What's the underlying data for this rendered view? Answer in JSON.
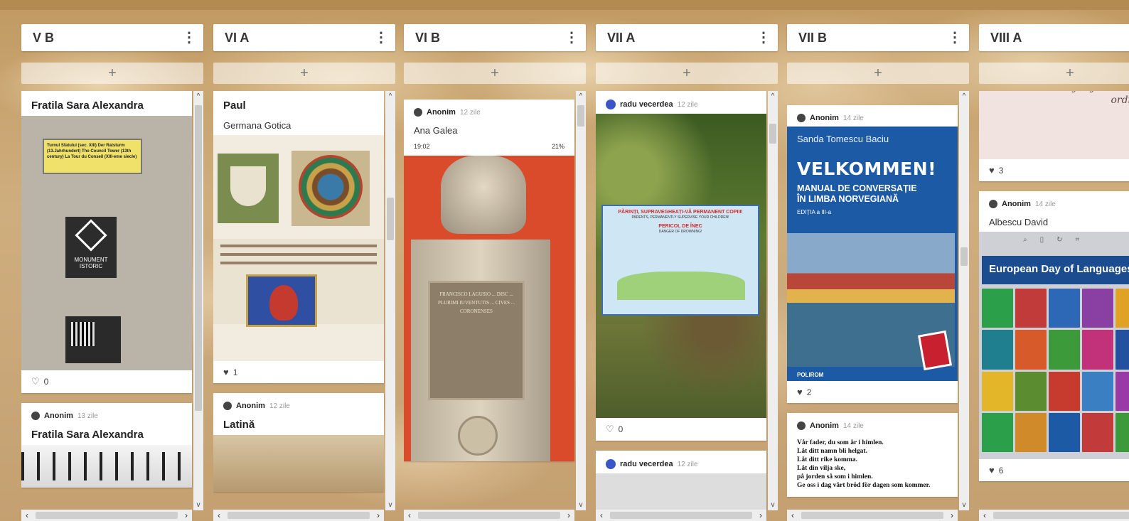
{
  "columns": [
    {
      "title": "V B",
      "add_label": "+",
      "cards": [
        {
          "title": "Fratila Sara Alexandra",
          "likes": "0"
        },
        {
          "author": "Anonim",
          "age": "13 zile",
          "title": "Fratila Sara Alexandra"
        }
      ],
      "sign": {
        "yellow": "Turnul Sfatului (sec. XIII) Der Ratsturm (13.Jahrhundert) The Council Tower (13th century) La Tour du Conseil (XIII-eme siecle)",
        "monument": "MONUMENT ISTORIC"
      }
    },
    {
      "title": "VI A",
      "add_label": "+",
      "cards": [
        {
          "title": "Paul",
          "subtitle": "Germana Gotica",
          "likes": "1"
        },
        {
          "author": "Anonim",
          "age": "12 zile",
          "title": "Latină"
        }
      ]
    },
    {
      "title": "VI B",
      "add_label": "+",
      "cards": [
        {
          "author": "Anonim",
          "age": "12 zile",
          "subtitle": "Ana Galea",
          "time": "19:02",
          "battery": "21%"
        }
      ],
      "plaque_text": "FRANCISCO LAGUSIO ... DISC ... PLURIMI IUVENTUTIS ... CIVES ... CORONENSES"
    },
    {
      "title": "VII A",
      "add_label": "+",
      "cards": [
        {
          "author": "radu vecerdea",
          "age": "12 zile",
          "likes": "0"
        },
        {
          "author": "radu vecerdea",
          "age": "12 zile"
        }
      ],
      "safety_sign": {
        "headline": "PĂRINȚI, SUPRAVEGHEAȚI-VĂ PERMANENT COPIII!",
        "headline_en": "PARENTS, PERMANENTLY SUPERVISE YOUR CHILDREN!",
        "danger": "PERICOL DE ÎNEC",
        "danger_en": "DANGER OF DROWNING!"
      }
    },
    {
      "title": "VII B",
      "add_label": "+",
      "cards": [
        {
          "author": "Anonim",
          "age": "14 zile",
          "likes": "2"
        },
        {
          "author": "Anonim",
          "age": "14 zile"
        }
      ],
      "book": {
        "author": "Sanda Tomescu Baciu",
        "title": "VELKOMMEN!",
        "subtitle_1": "MANUAL DE CONVERSAȚIE",
        "subtitle_2": "ÎN LIMBA NORVEGIANĂ",
        "edition": "EDIȚIA a III-a",
        "publisher": "POLIROM"
      },
      "poem": [
        "Vår fader, du som är i himlen.",
        "Låt ditt namn bli helgat.",
        "Låt ditt rike komma.",
        "Låt din vilja ske,",
        "på jorden så som i himlen.",
        "Ge oss i dag vårt bröd för dagen som kommer."
      ]
    },
    {
      "title": "VIII A",
      "add_label": "+",
      "cards": [
        {
          "quote": "Make everyday a little less ordinary",
          "likes": "3"
        },
        {
          "author": "Anonim",
          "age": "14 zile",
          "subtitle": "Albescu David",
          "likes": "6"
        }
      ],
      "eu_title": "European Day of Languages"
    }
  ],
  "colors": {
    "board_bg": "#c9a877",
    "card_bg": "#ffffff",
    "avatar_blue": "#3a55c8",
    "book_blue": "#1d5aa6",
    "bust_red": "#d94b2a"
  }
}
